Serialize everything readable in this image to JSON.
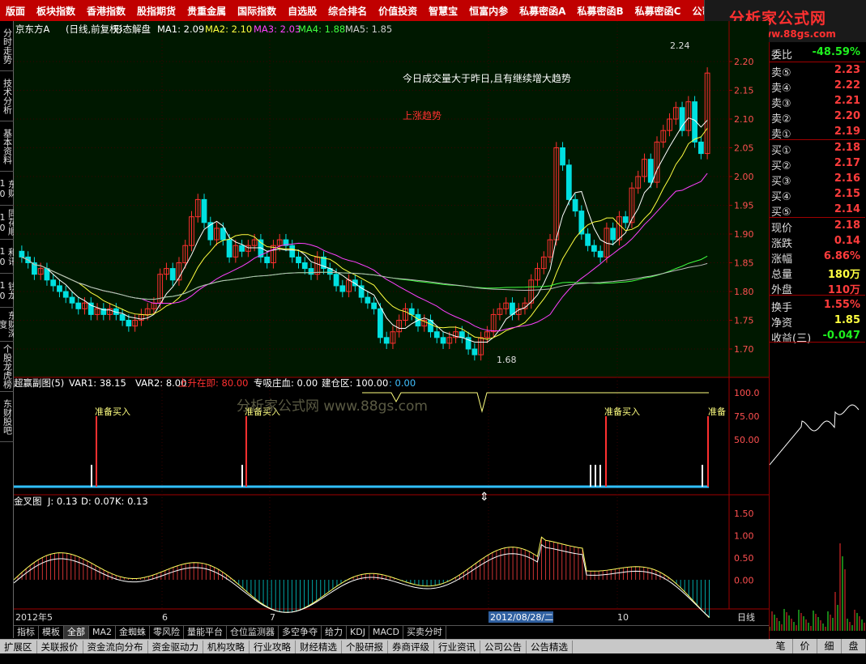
{
  "top_menu": [
    "版面",
    "板块指数",
    "香港指数",
    "股指期货",
    "贵重金属",
    "国际指数",
    "自选股",
    "综合排名",
    "价值投资",
    "智慧宝",
    "恒富内参",
    "私募密函A",
    "私募密函B",
    "私募密函C",
    "公司"
  ],
  "logo": {
    "title": "分析家公式网",
    "url": "www.88gs.com"
  },
  "left_tabs": [
    "分时走势",
    "技术分析",
    "基本资料",
    "东财10",
    "同花顺10",
    "和讯10",
    "钱龙10",
    "东财深度",
    "个股龙虎榜",
    "东财股吧"
  ],
  "main_info": {
    "stock": "京东方A",
    "period": "(日线,前复权)",
    "formula": "形态解盘",
    "ma": [
      {
        "label": "MA1: 2.09",
        "color": "#ffffff"
      },
      {
        "label": "MA2: 2.10",
        "color": "#ffff40"
      },
      {
        "label": "MA3: 2.03",
        "color": "#ff40ff"
      },
      {
        "label": "MA4: 1.88",
        "color": "#40ff40"
      },
      {
        "label": "MA5: 1.85",
        "color": "#cccccc"
      }
    ]
  },
  "annotations": {
    "note1": "今日成交量大于昨日,且有继续增大趋势",
    "note2": "上涨趋势",
    "high": "2.24",
    "low": "1.68"
  },
  "price_axis": [
    "2.20",
    "2.15",
    "2.10",
    "2.05",
    "2.00",
    "1.95",
    "1.90",
    "1.85",
    "1.80",
    "1.75",
    "1.70"
  ],
  "sub1": {
    "title": "超赢副图(5)",
    "var1": "VAR1: 38.15",
    "var2": "VAR2: 8.00",
    "up": "上升在即: 80.00",
    "chip": "专吸庄血: 0.00",
    "build": "建仓区: 100.00",
    "build2": ": 0.00",
    "signal": "准备买入",
    "signal_short": "准备",
    "axis": [
      "100.0",
      "75.00",
      "50.00"
    ],
    "watermark": "分析家公式网 www.88gs.com"
  },
  "sub2": {
    "title": "金叉图",
    "j": "J: 0.13",
    "d": "D: 0.07",
    "k": "K: 0.13",
    "axis": [
      "1.50",
      "1.00",
      "0.50",
      "0.00"
    ]
  },
  "date_axis": {
    "start": "2012年5",
    "m6": "6",
    "m7": "7",
    "cursor": "2012/08/28/二",
    "m10": "10",
    "label": "日线"
  },
  "quote": {
    "weibi": {
      "k": "委比",
      "v": "-48.59%"
    },
    "sell": [
      {
        "k": "卖⑤",
        "v": "2.23"
      },
      {
        "k": "卖④",
        "v": "2.22"
      },
      {
        "k": "卖③",
        "v": "2.21"
      },
      {
        "k": "卖②",
        "v": "2.20"
      },
      {
        "k": "卖①",
        "v": "2.19"
      }
    ],
    "buy": [
      {
        "k": "买①",
        "v": "2.18"
      },
      {
        "k": "买②",
        "v": "2.17"
      },
      {
        "k": "买③",
        "v": "2.16"
      },
      {
        "k": "买④",
        "v": "2.15"
      },
      {
        "k": "买⑤",
        "v": "2.14"
      }
    ],
    "stats": [
      {
        "k": "现价",
        "v": "2.18"
      },
      {
        "k": "涨跌",
        "v": "0.14"
      },
      {
        "k": "涨幅",
        "v": "6.86%"
      },
      {
        "k": "总量",
        "v": "180万"
      },
      {
        "k": "外盘",
        "v": "110万"
      }
    ],
    "stats2": [
      {
        "k": "换手",
        "v": "1.55%"
      },
      {
        "k": "净资",
        "v": "1.85"
      },
      {
        "k": "收益(三)",
        "v": "-0.047"
      }
    ]
  },
  "bottom_tabs1": [
    "指标",
    "模板",
    "全部",
    "MA2",
    "金蜘蛛",
    "零风险",
    "量能平台",
    "仓位监测器",
    "多空争夺",
    "给力",
    "KDJ",
    "MACD",
    "买卖分时"
  ],
  "bottom_tabs2": [
    "扩展区",
    "关联报价",
    "资金流向分布",
    "资金驱动力",
    "机构攻略",
    "行业攻略",
    "财经精选",
    "个股研报",
    "券商评级",
    "行业资讯",
    "公司公告",
    "公告精选"
  ],
  "right_bottom_tabs": [
    "笔",
    "价",
    "细",
    "盘"
  ],
  "chart_data": {
    "type": "candlestick",
    "title": "京东方A (日线,前复权)",
    "ylim": [
      1.68,
      2.24
    ],
    "high": 2.24,
    "low": 1.68,
    "last_close": 2.18
  }
}
